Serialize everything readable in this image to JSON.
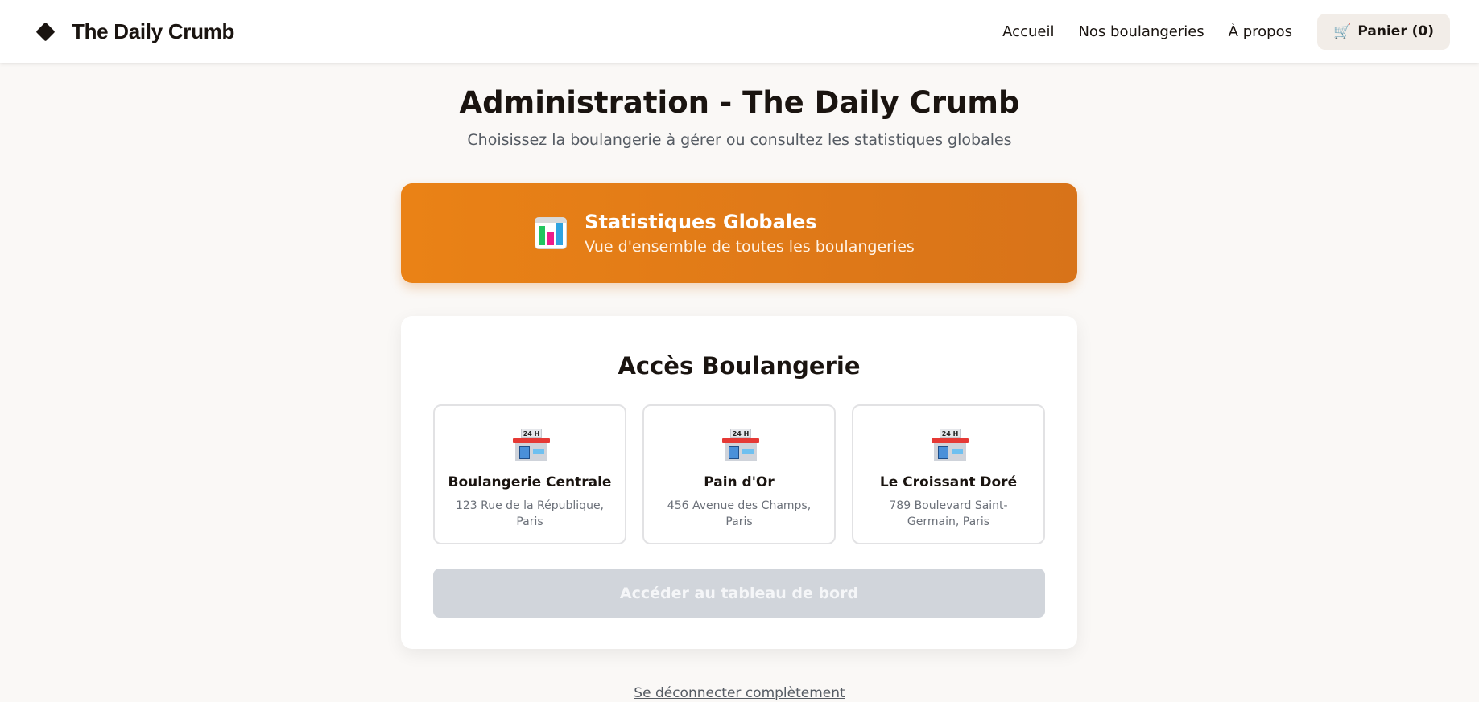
{
  "header": {
    "brand": "The Daily Crumb",
    "nav": [
      "Accueil",
      "Nos boulangeries",
      "À propos"
    ],
    "cart_label": "Panier (0)"
  },
  "page": {
    "title": "Administration - The Daily Crumb",
    "subtitle": "Choisissez la boulangerie à gérer ou consultez les statistiques globales"
  },
  "stats_card": {
    "title": "Statistiques Globales",
    "subtitle": "Vue d'ensemble de toutes les boulangeries",
    "icon": "bar-chart-icon"
  },
  "panel": {
    "title": "Accès Boulangerie",
    "bakeries": [
      {
        "name": "Boulangerie Centrale",
        "address": "123 Rue de la République, Paris",
        "icon_sign": "24 H"
      },
      {
        "name": "Pain d'Or",
        "address": "456 Avenue des Champs, Paris",
        "icon_sign": "24 H"
      },
      {
        "name": "Le Croissant Doré",
        "address": "789 Boulevard Saint-Germain, Paris",
        "icon_sign": "24 H"
      }
    ],
    "dashboard_button": "Accéder au tableau de bord"
  },
  "footer": {
    "logout": "Se déconnecter complètement"
  },
  "colors": {
    "accent": "#e67e17",
    "disabled_button": "#d1d5db"
  }
}
